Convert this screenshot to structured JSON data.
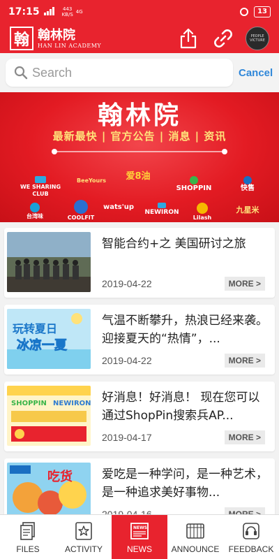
{
  "status_bar": {
    "time": "17:15",
    "network": "4G",
    "speed": "443",
    "speed_unit": "KB/S",
    "battery": "13"
  },
  "header": {
    "logo_mark": "翰",
    "logo_title": "翰林院",
    "logo_subtitle": "HAN LIN ACADEMY",
    "avatar_text": "PEOPLE VICTURE"
  },
  "search": {
    "placeholder": "Search",
    "cancel_label": "Cancel"
  },
  "banner": {
    "title": "翰林院",
    "subtitle": "最新最快 | 官方公告 | 消息 | 资讯",
    "logos": [
      "WE SHARING CLUB",
      "BeeYours",
      "爱8油",
      "SHOPPIN",
      "快售",
      "台湾味",
      "COOLFIT",
      "wats'up",
      "NEWIRON",
      "Lilash",
      "九星米"
    ]
  },
  "news": [
    {
      "title": "智能合约+之 美国研讨之旅",
      "date": "2019-04-22",
      "more": "MORE >"
    },
    {
      "title": "气温不断攀升，热浪已经来袭。迎接夏天的“热情”，...",
      "date": "2019-04-22",
      "more": "MORE >"
    },
    {
      "title": "好消息！好消息！ 现在您可以通过ShopPin搜索兵AP...",
      "date": "2019-04-17",
      "more": "MORE >"
    },
    {
      "title": "爱吃是一种学问，是一种艺术，是一种追求美好事物...",
      "date": "2019-04-16",
      "more": "MORE >"
    }
  ],
  "tabs": [
    {
      "label": "FILES",
      "icon": "files-icon"
    },
    {
      "label": "ACTIVITY",
      "icon": "activity-icon"
    },
    {
      "label": "NEWS",
      "icon": "news-icon",
      "active": true
    },
    {
      "label": "ANNOUNCE",
      "icon": "announce-icon"
    },
    {
      "label": "FEEDBACK",
      "icon": "feedback-icon"
    }
  ],
  "colors": {
    "brand_red": "#e8232e",
    "banner_yellow": "#ffe27a",
    "link_blue": "#2f87d9"
  }
}
